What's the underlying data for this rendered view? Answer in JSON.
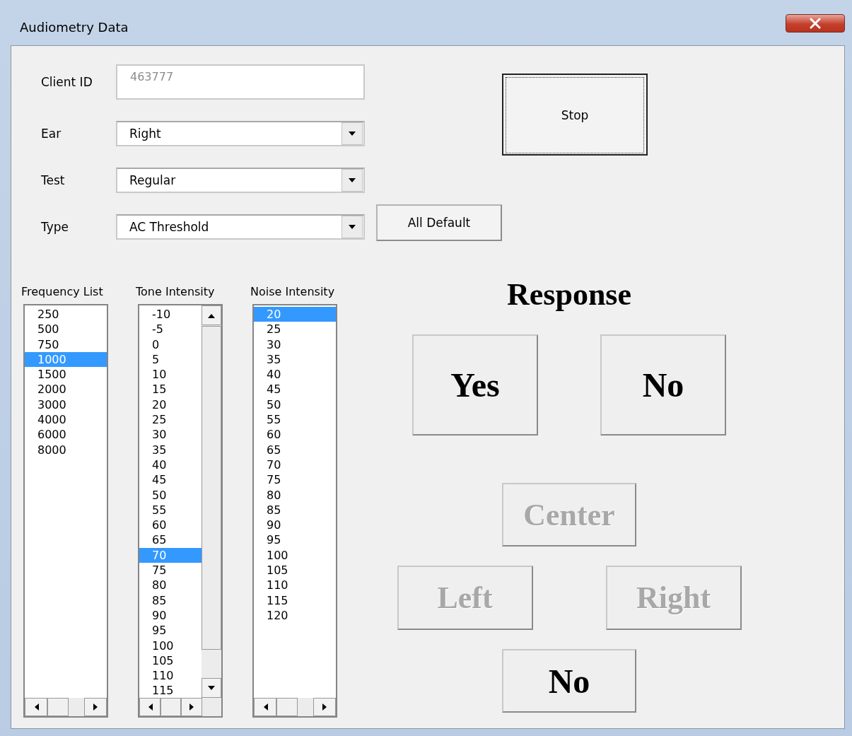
{
  "window": {
    "title": "Audiometry Data"
  },
  "fields": [
    {
      "kind": "text",
      "label": "Client ID",
      "value": "463777",
      "disabled": true
    },
    {
      "kind": "dropdown",
      "label": "Ear",
      "value": "Right"
    },
    {
      "kind": "dropdown",
      "label": "Test",
      "value": "Regular"
    },
    {
      "kind": "dropdown",
      "label": "Type",
      "value": "AC Threshold"
    }
  ],
  "stop_button": {
    "label": "Stop"
  },
  "all_default_button": {
    "label": "All Default"
  },
  "lists": [
    {
      "label": "Frequency List",
      "vscroll": false,
      "items": [
        {
          "text": "250",
          "selected": false
        },
        {
          "text": "500",
          "selected": false
        },
        {
          "text": "750",
          "selected": false
        },
        {
          "text": "1000",
          "selected": true
        },
        {
          "text": "1500",
          "selected": false
        },
        {
          "text": "2000",
          "selected": false
        },
        {
          "text": "3000",
          "selected": false
        },
        {
          "text": "4000",
          "selected": false
        },
        {
          "text": "6000",
          "selected": false
        },
        {
          "text": "8000",
          "selected": false
        }
      ]
    },
    {
      "label": "Tone Intensity",
      "vscroll": true,
      "items": [
        {
          "text": "-10",
          "selected": false
        },
        {
          "text": "-5",
          "selected": false
        },
        {
          "text": "0",
          "selected": false
        },
        {
          "text": "5",
          "selected": false
        },
        {
          "text": "10",
          "selected": false
        },
        {
          "text": "15",
          "selected": false
        },
        {
          "text": "20",
          "selected": false
        },
        {
          "text": "25",
          "selected": false
        },
        {
          "text": "30",
          "selected": false
        },
        {
          "text": "35",
          "selected": false
        },
        {
          "text": "40",
          "selected": false
        },
        {
          "text": "45",
          "selected": false
        },
        {
          "text": "50",
          "selected": false
        },
        {
          "text": "55",
          "selected": false
        },
        {
          "text": "60",
          "selected": false
        },
        {
          "text": "65",
          "selected": false
        },
        {
          "text": "70",
          "selected": true
        },
        {
          "text": "75",
          "selected": false
        },
        {
          "text": "80",
          "selected": false
        },
        {
          "text": "85",
          "selected": false
        },
        {
          "text": "90",
          "selected": false
        },
        {
          "text": "95",
          "selected": false
        },
        {
          "text": "100",
          "selected": false
        },
        {
          "text": "105",
          "selected": false
        },
        {
          "text": "110",
          "selected": false
        },
        {
          "text": "115",
          "selected": false
        }
      ]
    },
    {
      "label": "Noise Intensity",
      "vscroll": false,
      "items": [
        {
          "text": "20",
          "selected": true
        },
        {
          "text": "25",
          "selected": false
        },
        {
          "text": "30",
          "selected": false
        },
        {
          "text": "35",
          "selected": false
        },
        {
          "text": "40",
          "selected": false
        },
        {
          "text": "45",
          "selected": false
        },
        {
          "text": "50",
          "selected": false
        },
        {
          "text": "55",
          "selected": false
        },
        {
          "text": "60",
          "selected": false
        },
        {
          "text": "65",
          "selected": false
        },
        {
          "text": "70",
          "selected": false
        },
        {
          "text": "75",
          "selected": false
        },
        {
          "text": "80",
          "selected": false
        },
        {
          "text": "85",
          "selected": false
        },
        {
          "text": "90",
          "selected": false
        },
        {
          "text": "95",
          "selected": false
        },
        {
          "text": "100",
          "selected": false
        },
        {
          "text": "105",
          "selected": false
        },
        {
          "text": "110",
          "selected": false
        },
        {
          "text": "115",
          "selected": false
        },
        {
          "text": "120",
          "selected": false
        }
      ]
    }
  ],
  "response": {
    "title": "Response",
    "buttons": [
      {
        "label": "Yes",
        "disabled": false
      },
      {
        "label": "No",
        "disabled": false
      },
      {
        "label": "Center",
        "disabled": true
      },
      {
        "label": "Left",
        "disabled": true
      },
      {
        "label": "Right",
        "disabled": true
      },
      {
        "label": "No",
        "disabled": false
      }
    ]
  }
}
